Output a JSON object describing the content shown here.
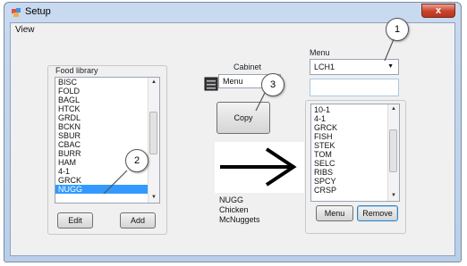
{
  "window": {
    "title": "Setup",
    "close_label": "x"
  },
  "menubar": {
    "view": "View"
  },
  "food_library": {
    "label": "Food library",
    "items": [
      "BISC",
      "FOLD",
      "BAGL",
      "HTCK",
      "GRDL",
      "BCKN",
      "SBUR",
      "CBAC",
      "BURR",
      "HAM",
      "4-1",
      "GRCK",
      "NUGG"
    ],
    "selected": "NUGG",
    "edit_button": "Edit",
    "add_button": "Add"
  },
  "cabinet": {
    "label": "Cabinet",
    "menu_label": "Menu",
    "copy_button": "Copy",
    "icon": "cabinet-icon"
  },
  "info": {
    "line1": "NUGG",
    "line2": "Chicken",
    "line3": "McNuggets"
  },
  "menu_panel": {
    "label": "Menu",
    "selected": "LCH1",
    "items": [
      "10-1",
      "4-1",
      "GRCK",
      "FISH",
      "STEK",
      "TOM",
      "SELC",
      "RIBS",
      "SPCY",
      "CRSP"
    ],
    "menu_button": "Menu",
    "remove_button": "Remove"
  },
  "callouts": [
    "1",
    "2",
    "3"
  ],
  "colors": {
    "selection": "#3399ff",
    "close": "#c7432b"
  }
}
